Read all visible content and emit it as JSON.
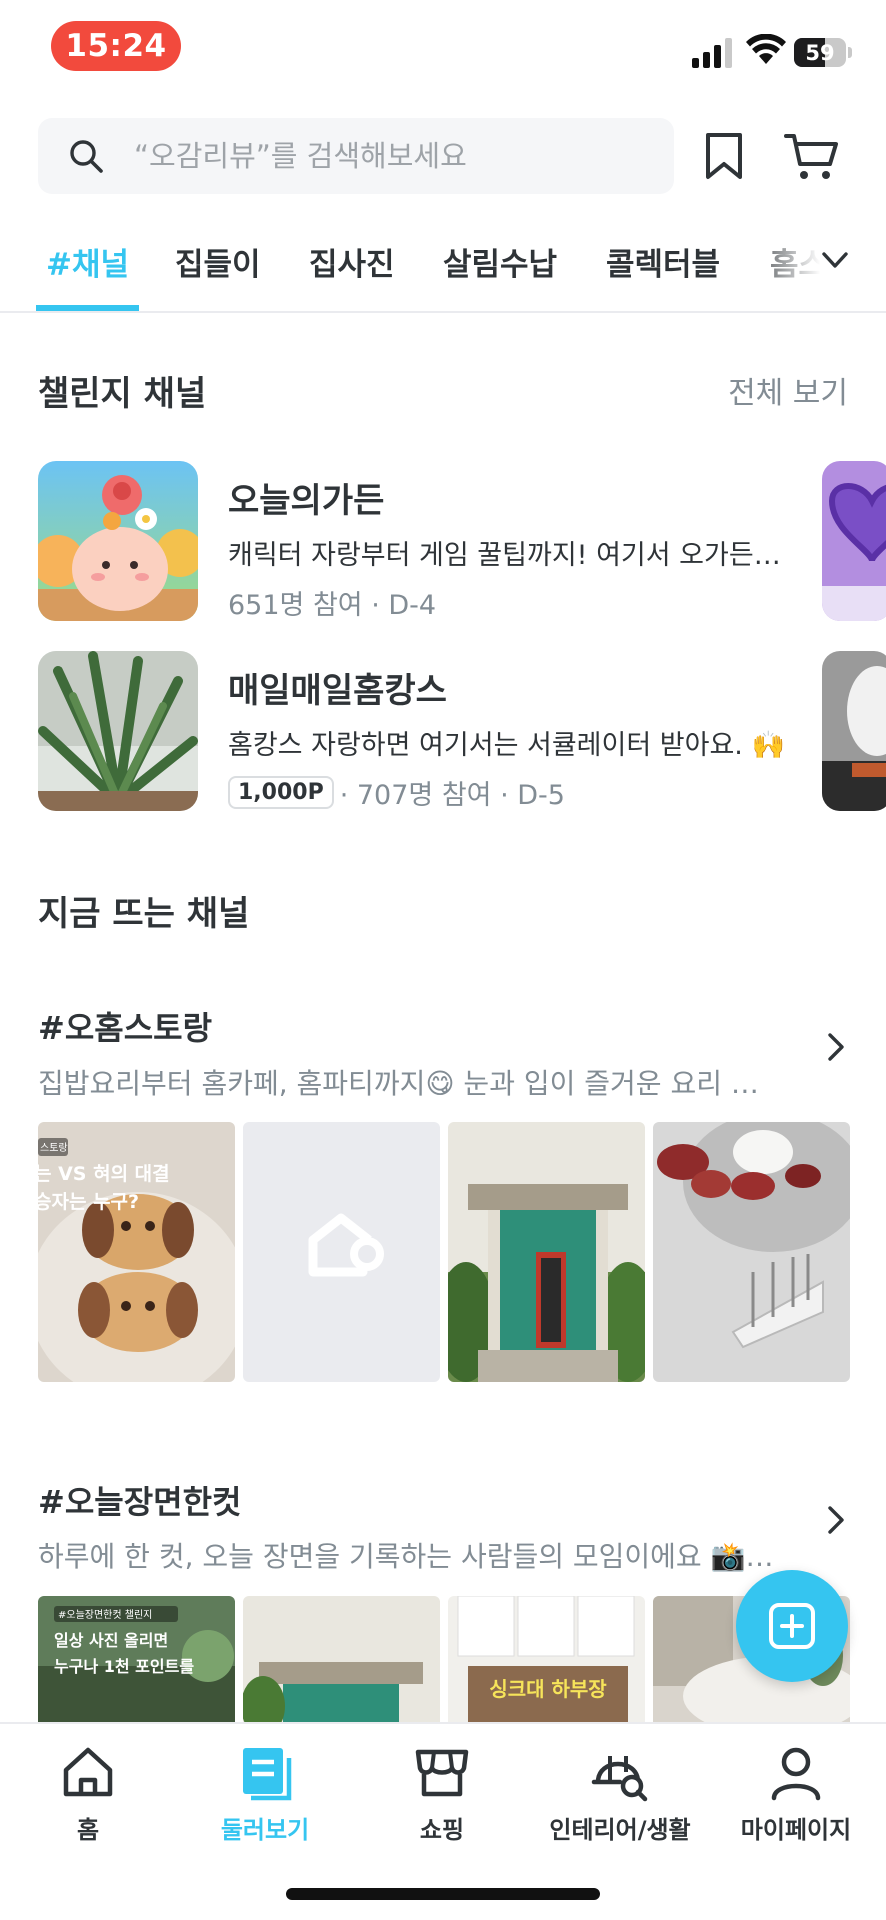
{
  "status_bar": {
    "time": "15:24",
    "battery": "59",
    "battery_level": 0.59
  },
  "search": {
    "placeholder": "“오감리뷰”를 검색해보세요",
    "icons": [
      "search-icon",
      "bookmark-icon",
      "cart-icon"
    ]
  },
  "tabs": [
    {
      "label": "#채널",
      "active": true
    },
    {
      "label": "집들이"
    },
    {
      "label": "집사진"
    },
    {
      "label": "살림수납"
    },
    {
      "label": "콜렉터블"
    },
    {
      "label": "홈스"
    }
  ],
  "challenge_section": {
    "title": "챌린지 채널",
    "see_all": "전체 보기",
    "items": [
      {
        "title": "오늘의가든",
        "desc": "캐릭터 자랑부터 게임 꿀팁까지! 여기서 오가든 게임 이야기 나눠요",
        "meta": "651명 참여 · D-4"
      },
      {
        "title": "매일매일홈캉스",
        "desc": "홈캉스 자랑하면 여기서는 서큘레이터 받아요. 🙌",
        "badge": "1,000P",
        "meta": " · 707명 참여 · D-5"
      }
    ]
  },
  "hot_section": {
    "title": "지금 뜨는 채널",
    "channels": [
      {
        "title": "#오홈스토랑",
        "desc": "집밥요리부터 홈카페, 홈파티까지😋 눈과 입이 즐거운 요리 이야기를 나눠요",
        "image_overlay": [
          "스토랑",
          "는 VS 혀의 대결",
          "승자는 누구?"
        ]
      },
      {
        "title": "#오늘장면한컷",
        "desc": "하루에 한 컷, 오늘 장면을 기록하는 사람들의 모임이에요 📸 함께해요",
        "image_overlay": [
          "#오늘장면한컷 챌린지",
          "일상 사진 올리면",
          "누구나 1천 포인트를"
        ],
        "sink_caption": "싱크대 하부장"
      }
    ]
  },
  "bottom_nav": [
    {
      "label": "홈",
      "icon": "home-icon"
    },
    {
      "label": "둘러보기",
      "icon": "browse-icon",
      "active": true
    },
    {
      "label": "쇼핑",
      "icon": "store-icon"
    },
    {
      "label": "인테리어/생활",
      "icon": "interior-search-icon"
    },
    {
      "label": "마이페이지",
      "icon": "profile-icon"
    }
  ],
  "colors": {
    "accent": "#35c5f0",
    "text": "#2f3438",
    "muted": "#828c94",
    "time_pill": "#f24a3d"
  }
}
